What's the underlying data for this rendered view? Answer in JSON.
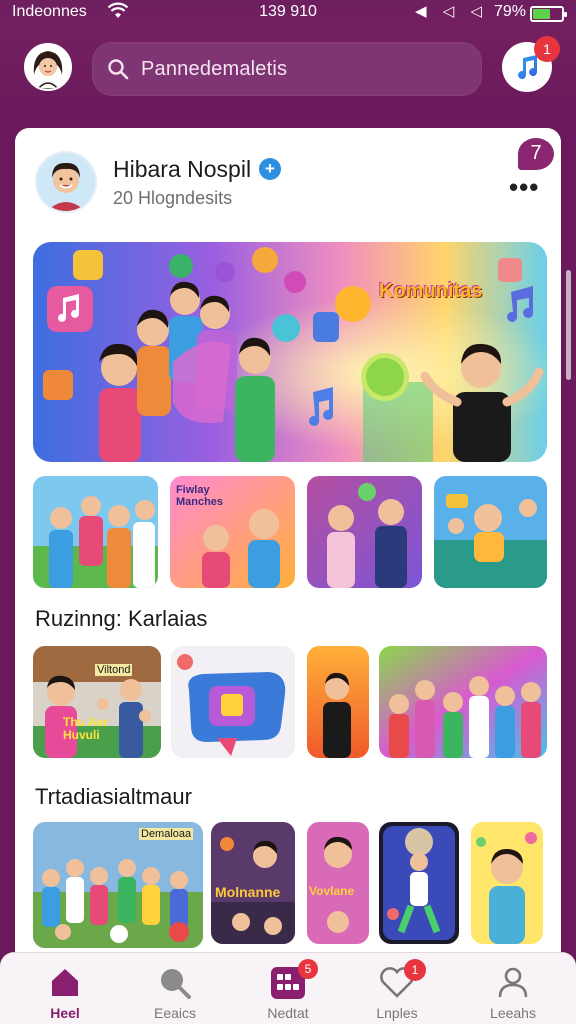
{
  "status_bar": {
    "carrier": "Indeonnes",
    "time": "139 910",
    "battery_percent": "79%",
    "battery_level": 0.62,
    "battery_color": "#5ed34a"
  },
  "header": {
    "avatar_icon": "user-avatar",
    "search_placeholder": "Pannedemaletis",
    "search_icon": "search-icon",
    "music_icon": "music-note-icon",
    "music_badge": "1"
  },
  "post": {
    "author_name": "Hibara Nospil",
    "verified": true,
    "subtitle": "20 Hlogndesits",
    "notification_count": "7",
    "more_icon": "more-dots-icon",
    "hero_text": "Komunitas"
  },
  "sections": [
    {
      "title": "Ruzinng: Karlaias"
    },
    {
      "title": "Trtadiasialtmaur"
    }
  ],
  "thumb_texts": {
    "row1_card2": "Fiwlay Manches",
    "row2_card1": "Viltond",
    "row2_card1b": "Thu Aar Huvuli",
    "row3_card2": "Molnanne",
    "row3_card3": "Vovlane",
    "row3_card1": "Demaloaa"
  },
  "bottom_nav": [
    {
      "label": "Heel",
      "icon": "home-icon",
      "active": true,
      "badge": ""
    },
    {
      "label": "Eeaics",
      "icon": "search-icon",
      "active": false,
      "badge": ""
    },
    {
      "label": "Nedtat",
      "icon": "grid-icon",
      "active": false,
      "badge": "5"
    },
    {
      "label": "Lnples",
      "icon": "heart-icon",
      "active": false,
      "badge": "1"
    },
    {
      "label": "Leeahs",
      "icon": "profile-icon",
      "active": false,
      "badge": ""
    }
  ],
  "colors": {
    "brand_purple": "#6a1a5c",
    "accent": "#8a1f70",
    "badge_red": "#e7353f",
    "verified_blue": "#2e8fe0"
  }
}
